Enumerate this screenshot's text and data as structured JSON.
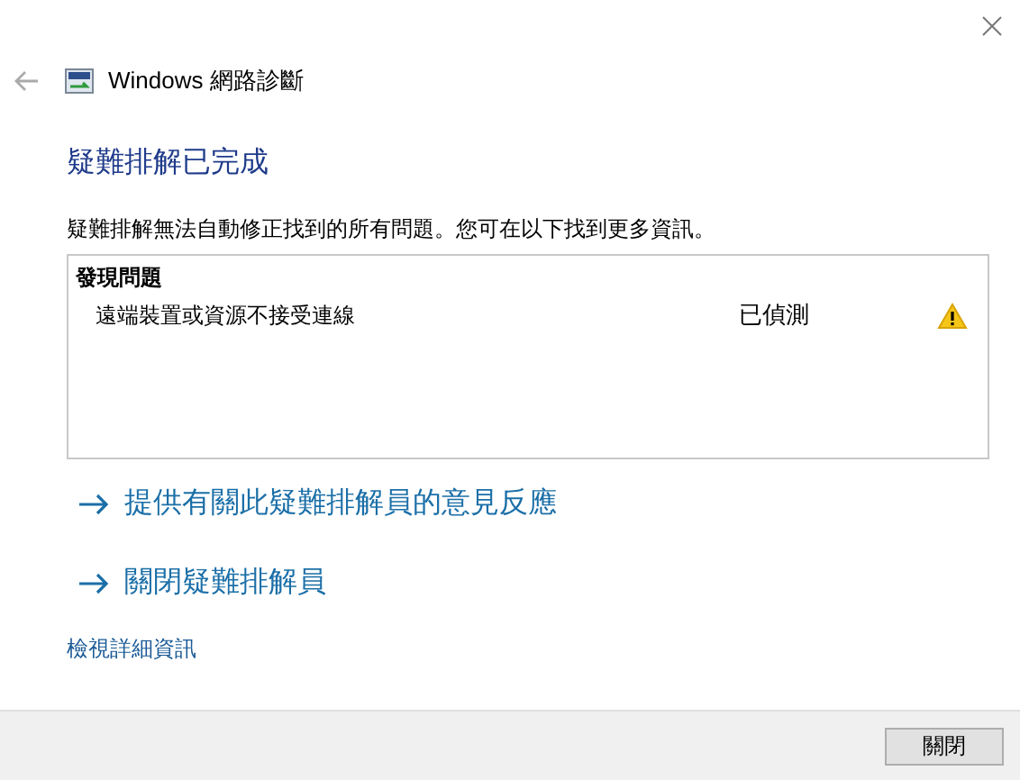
{
  "window": {
    "title": "Windows 網路診斷"
  },
  "heading": "疑難排解已完成",
  "description": "疑難排解無法自動修正找到的所有問題。您可在以下找到更多資訊。",
  "problems": {
    "header": "發現問題",
    "items": [
      {
        "name": "遠端裝置或資源不接受連線",
        "status": "已偵測",
        "kind": "warning"
      }
    ]
  },
  "actions": [
    {
      "label": "提供有關此疑難排解員的意見反應"
    },
    {
      "label": "關閉疑難排解員"
    }
  ],
  "details_link": "檢視詳細資訊",
  "buttons": [
    {
      "label": "關閉"
    }
  ]
}
